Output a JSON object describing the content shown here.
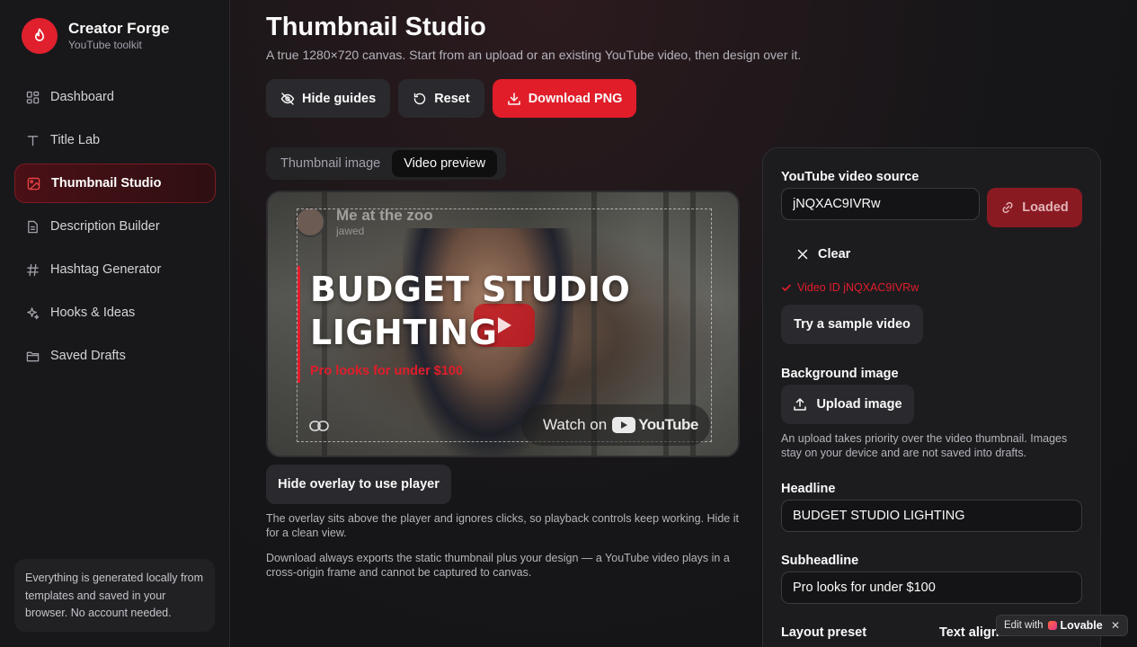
{
  "brand": {
    "name": "Creator Forge",
    "subtitle": "YouTube toolkit"
  },
  "nav": {
    "items": [
      {
        "label": "Dashboard",
        "icon": "dashboard-icon",
        "active": false
      },
      {
        "label": "Title Lab",
        "icon": "text-icon",
        "active": false
      },
      {
        "label": "Thumbnail Studio",
        "icon": "image-icon",
        "active": true
      },
      {
        "label": "Description Builder",
        "icon": "document-icon",
        "active": false
      },
      {
        "label": "Hashtag Generator",
        "icon": "hash-icon",
        "active": false
      },
      {
        "label": "Hooks & Ideas",
        "icon": "sparkles-icon",
        "active": false
      },
      {
        "label": "Saved Drafts",
        "icon": "folder-icon",
        "active": false
      }
    ]
  },
  "side_note": "Everything is generated locally from templates and saved in your browser. No account needed.",
  "page": {
    "title": "Thumbnail Studio",
    "subtitle": "A true 1280×720 canvas. Start from an upload or an existing YouTube video, then design over it."
  },
  "toolbar": {
    "hide_guides": "Hide guides",
    "reset": "Reset",
    "download": "Download PNG"
  },
  "tabs": [
    {
      "label": "Thumbnail image",
      "active": false
    },
    {
      "label": "Video preview",
      "active": true
    }
  ],
  "preview": {
    "video_title": "Me at the zoo",
    "channel": "jawed",
    "headline_line1": "BUDGET STUDIO",
    "headline_line2": "LIGHTING",
    "subheadline": "Pro looks for under $100",
    "watch_on": "Watch on",
    "youtube_brand": "YouTube"
  },
  "hide_overlay": "Hide overlay to use player",
  "notes": {
    "overlay": "The overlay sits above the player and ignores clicks, so playback controls keep working. Hide it for a clean view.",
    "download": "Download always exports the static thumbnail plus your design — a YouTube video plays in a cross-origin frame and cannot be captured to canvas."
  },
  "panel": {
    "source_label": "YouTube video source",
    "source_value": "jNQXAC9IVRw",
    "loaded_label": "Loaded",
    "clear_label": "Clear",
    "video_id_status": "Video ID jNQXAC9IVRw",
    "sample_label": "Try a sample video",
    "bg_label": "Background image",
    "upload_label": "Upload image",
    "upload_note": "An upload takes priority over the video thumbnail. Images stay on your device and are not saved into drafts.",
    "headline_label": "Headline",
    "headline_value": "BUDGET STUDIO LIGHTING",
    "subheadline_label": "Subheadline",
    "subheadline_value": "Pro looks for under $100",
    "layout_label": "Layout preset",
    "align_label": "Text alignment"
  },
  "badge": {
    "edit_with": "Edit with",
    "brand": "Lovable",
    "close": "✕"
  },
  "colors": {
    "accent": "#e11d2a",
    "background": "#141416",
    "sidebar": "#18181b"
  }
}
